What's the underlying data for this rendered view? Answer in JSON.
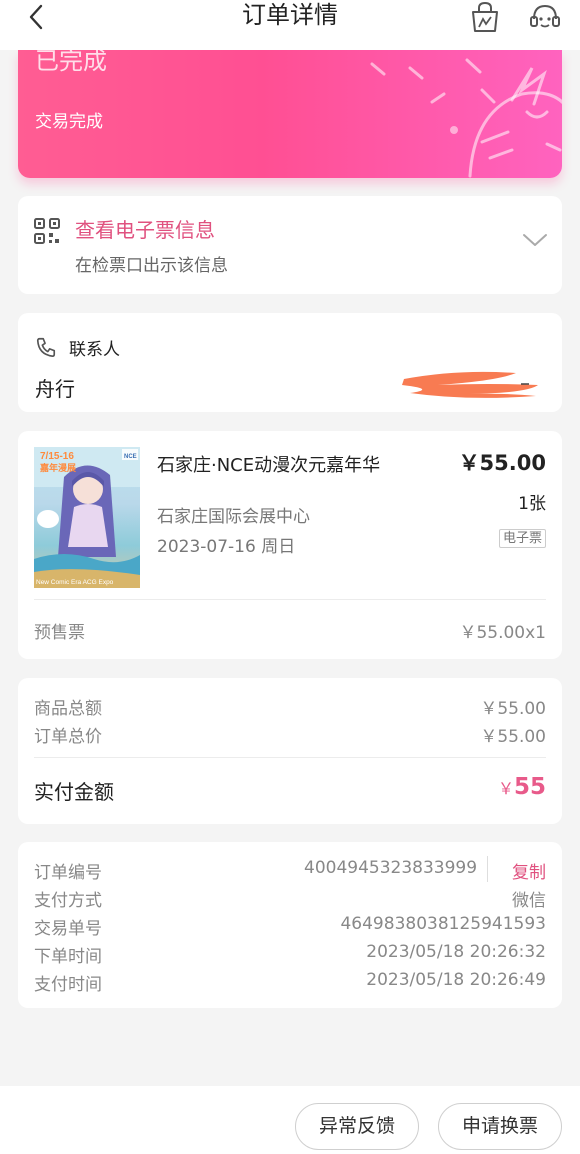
{
  "header": {
    "title": "订单详情"
  },
  "status": {
    "title": "已完成",
    "subtitle": "交易完成"
  },
  "eticket": {
    "title": "查看电子票信息",
    "subtitle": "在检票口出示该信息"
  },
  "contact": {
    "label": "联系人",
    "name": "舟行"
  },
  "item": {
    "title": "石家庄·NCE动漫次元嘉年华",
    "price": "￥55.00",
    "quantity": "1张",
    "venue": "石家庄国际会展中心",
    "date": "2023-07-16 周日",
    "badge": "电子票",
    "ticket_type": "预售票",
    "ticket_unit": "￥55.00x1",
    "poster_text": [
      "7/15-16",
      "嘉年漫展",
      "NCE",
      "New Comic Era ACG Expo"
    ]
  },
  "summary": {
    "goods_total_label": "商品总额",
    "goods_total": "￥55.00",
    "order_total_label": "订单总价",
    "order_total": "￥55.00",
    "paid_label": "实付金额",
    "paid_currency": "￥",
    "paid_amount": "55"
  },
  "order_info": {
    "order_no_label": "订单编号",
    "order_no": "4004945323833999",
    "copy_label": "复制",
    "payment_method_label": "支付方式",
    "payment_method": "微信",
    "transaction_no_label": "交易单号",
    "transaction_no": "4649838038125941593",
    "order_time_label": "下单时间",
    "order_time": "2023/05/18 20:26:32",
    "pay_time_label": "支付时间",
    "pay_time": "2023/05/18 20:26:49"
  },
  "actions": {
    "feedback": "异常反馈",
    "exchange": "申请换票"
  },
  "colors": {
    "accent": "#e0517f",
    "banner_start": "#ff5d93",
    "banner_end": "#ff63bf"
  }
}
